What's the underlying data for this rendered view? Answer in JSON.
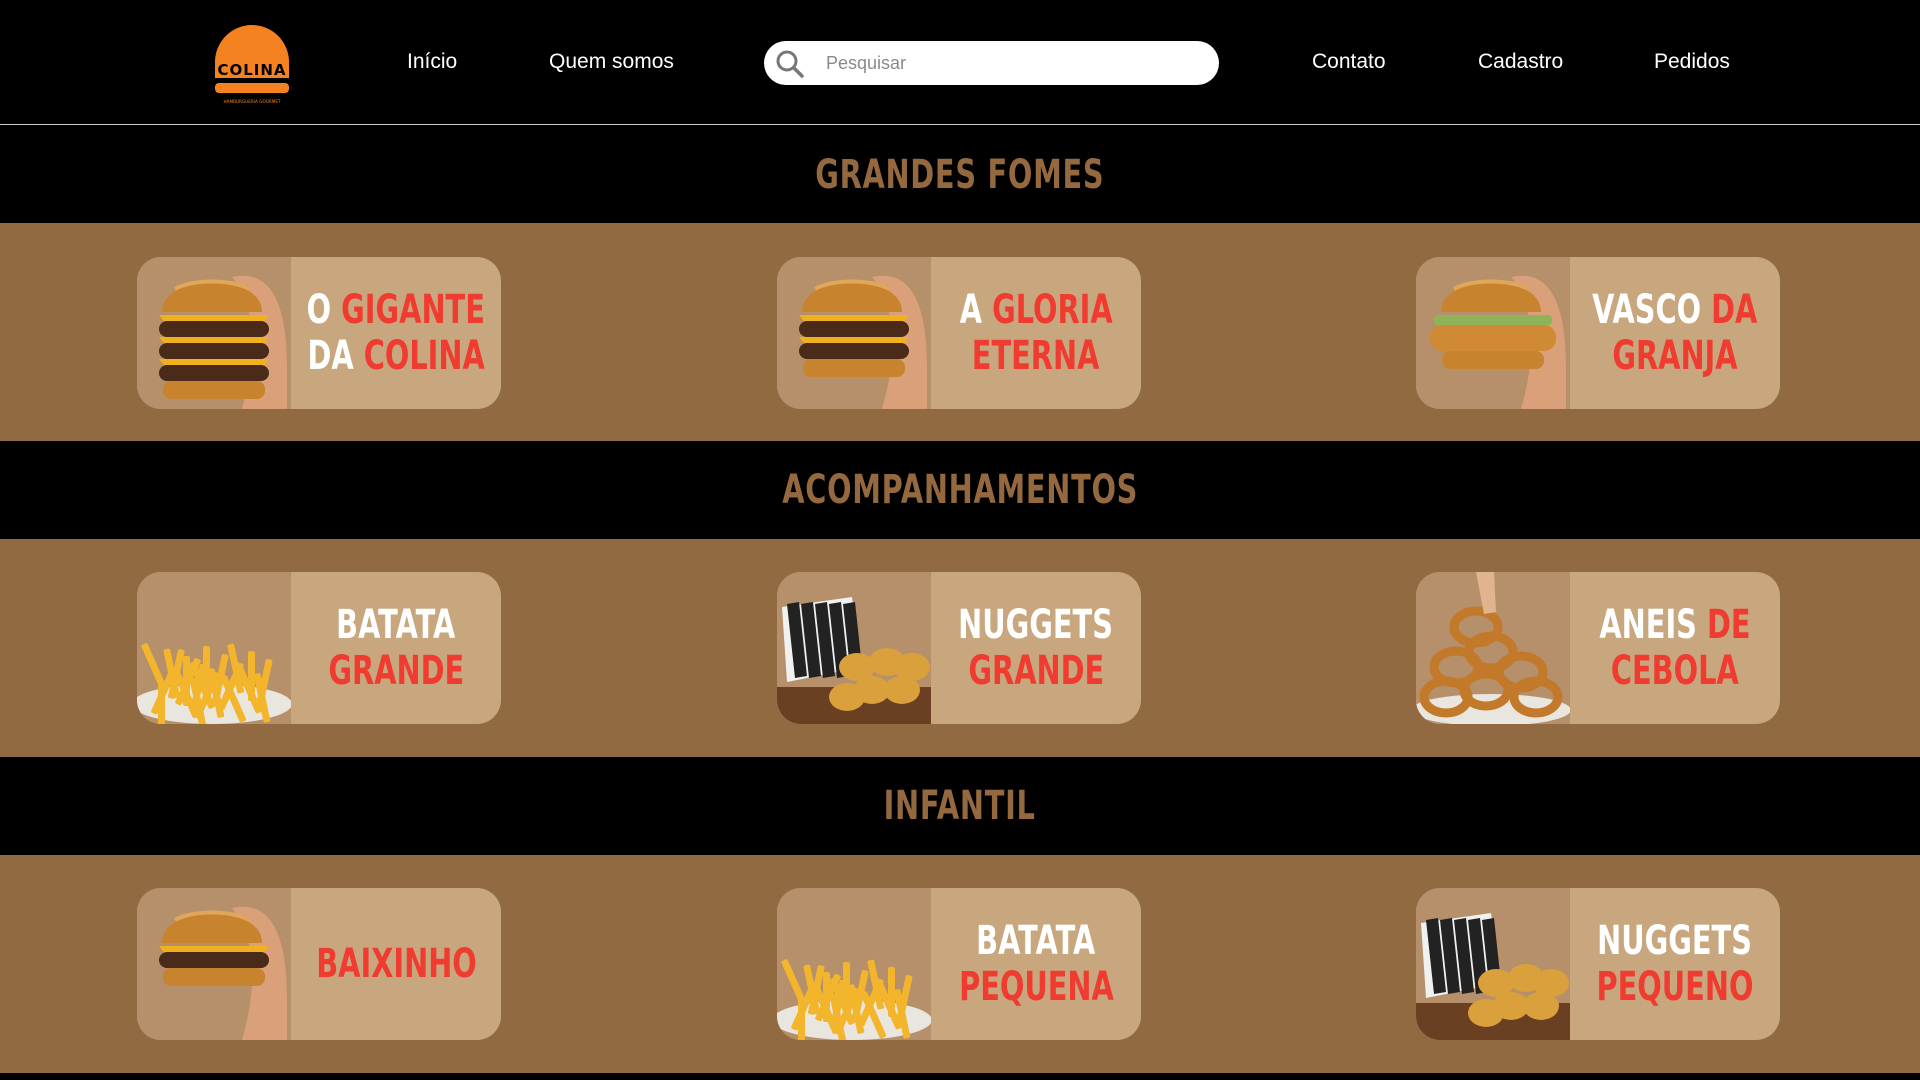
{
  "header": {
    "logo": {
      "brand": "COLINA",
      "tagline": "HAMBURGUERIA GOURMET",
      "icon": "burger-logo-icon"
    },
    "nav_left": [
      "Início",
      "Quem somos"
    ],
    "nav_right": [
      "Contato",
      "Cadastro",
      "Pedidos"
    ],
    "search": {
      "placeholder": "Pesquisar",
      "value": "",
      "icon": "search-icon"
    }
  },
  "sections": [
    {
      "title": "GRANDES FOMES",
      "items": [
        {
          "lines": [
            [
              "O ",
              "GIGANTE"
            ],
            [
              "DA ",
              "COLINA"
            ]
          ],
          "image": "triple-cheeseburger"
        },
        {
          "lines": [
            [
              "A ",
              "GLORIA"
            ],
            [
              "",
              "ETERNA"
            ]
          ],
          "image": "double-cheeseburger"
        },
        {
          "lines": [
            [
              "VASCO",
              " DA"
            ],
            [
              "",
              "GRANJA"
            ]
          ],
          "image": "chicken-sandwich"
        }
      ]
    },
    {
      "title": "ACOMPANHAMENTOS",
      "items": [
        {
          "lines": [
            [
              "BATATA",
              ""
            ],
            [
              "",
              "GRANDE"
            ]
          ],
          "image": "french-fries"
        },
        {
          "lines": [
            [
              "NUGGETS",
              ""
            ],
            [
              "",
              "GRANDE"
            ]
          ],
          "image": "chicken-nuggets"
        },
        {
          "lines": [
            [
              "ANEIS",
              " DE"
            ],
            [
              "",
              "CEBOLA"
            ]
          ],
          "image": "onion-rings"
        }
      ]
    },
    {
      "title": "INFANTIL",
      "items": [
        {
          "lines": [
            [
              "",
              "BAIXINHO"
            ]
          ],
          "image": "cheeseburger"
        },
        {
          "lines": [
            [
              "BATATA",
              ""
            ],
            [
              "",
              "PEQUENA"
            ]
          ],
          "image": "french-fries"
        },
        {
          "lines": [
            [
              "NUGGETS",
              ""
            ],
            [
              "",
              "PEQUENO"
            ]
          ],
          "image": "chicken-nuggets"
        }
      ]
    }
  ],
  "colors": {
    "background": "#000000",
    "section_band": "#926a42",
    "card": "#c9a77e",
    "section_title": "#94693f",
    "accent_red": "#ef3b30",
    "logo_orange": "#f58220"
  }
}
